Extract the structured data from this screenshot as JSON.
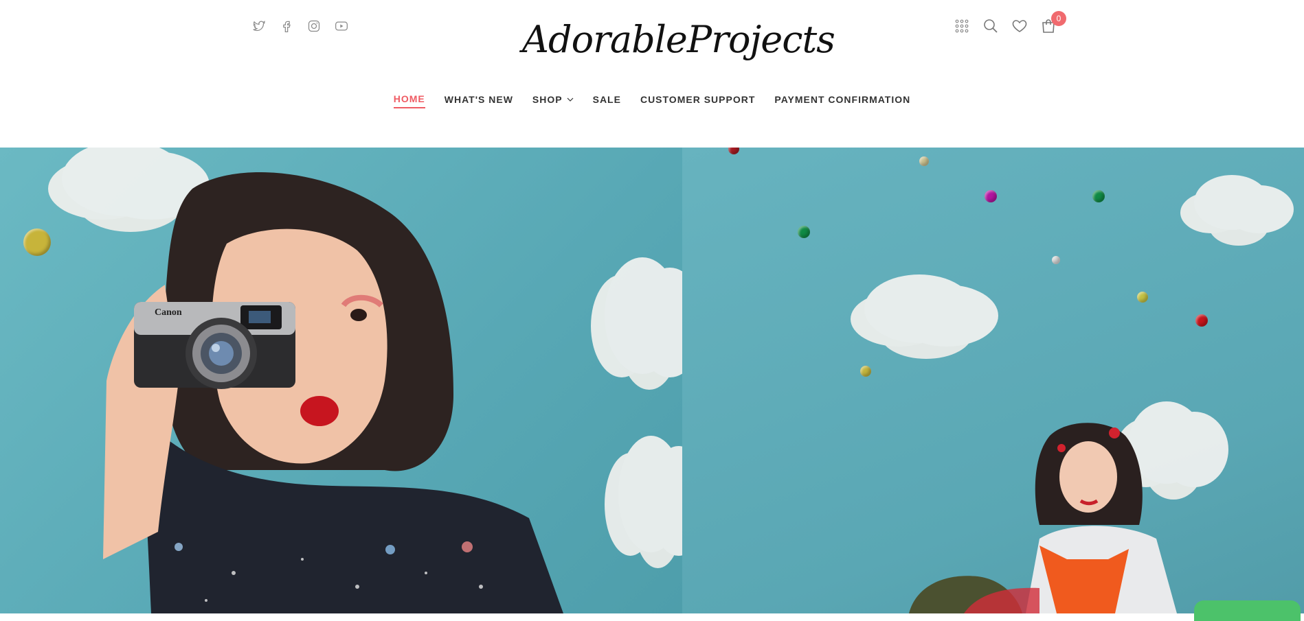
{
  "header": {
    "logo_text": "AdorableProjects",
    "social_icons": [
      "twitter-icon",
      "facebook-icon",
      "instagram-icon",
      "youtube-icon"
    ],
    "tool_icons": [
      "apps-grid-icon",
      "search-icon",
      "heart-icon",
      "shopping-bag-icon"
    ],
    "cart_count": "0"
  },
  "nav": {
    "items": [
      {
        "label": "HOME",
        "active": true
      },
      {
        "label": "WHAT'S NEW"
      },
      {
        "label": "SHOP",
        "has_dropdown": true
      },
      {
        "label": "SALE"
      },
      {
        "label": "CUSTOMER SUPPORT"
      },
      {
        "label": "PAYMENT CONFIRMATION"
      }
    ]
  },
  "colors": {
    "accent": "#ef5b63",
    "badge": "#f06a6e",
    "hero_bg": "#5fadb9",
    "chat": "#4cc26a"
  },
  "hero": {
    "left_image": "woman-with-vintage-camera-photo",
    "right_image": "woman-sitting-with-clouds-and-ornaments-photo"
  }
}
